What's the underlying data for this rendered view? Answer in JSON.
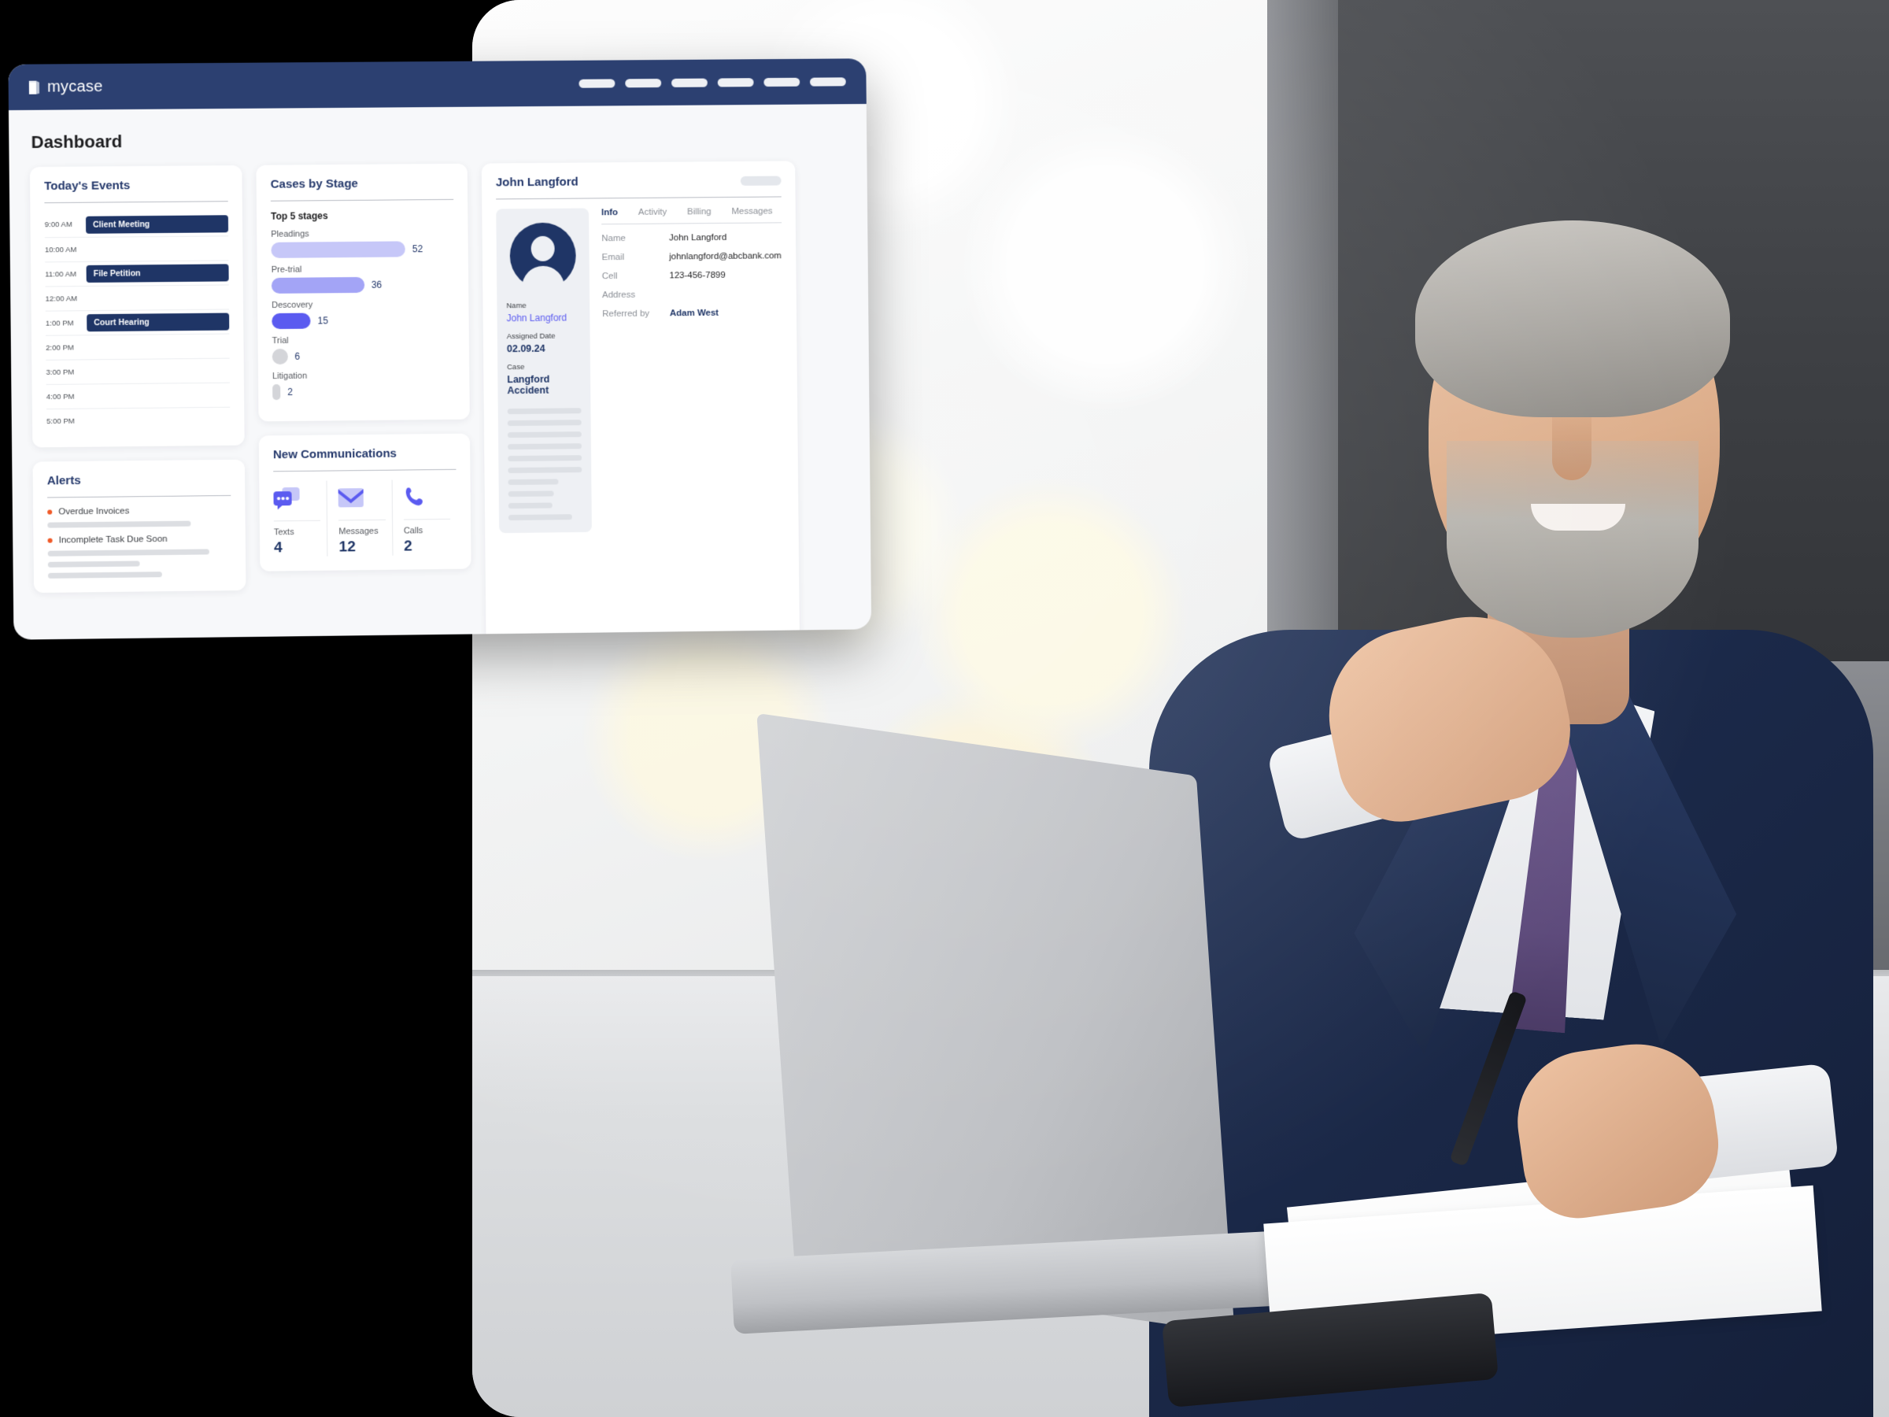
{
  "app": {
    "brand": "mycase",
    "brand_icon": "book-icon",
    "nav_placeholder_count": 6,
    "topbar_color": "#2c4071"
  },
  "page": {
    "title": "Dashboard"
  },
  "events_card": {
    "title": "Today's Events",
    "rows": [
      {
        "time": "9:00 AM",
        "event": "Client Meeting"
      },
      {
        "time": "10:00 AM",
        "event": ""
      },
      {
        "time": "11:00 AM",
        "event": "File Petition"
      },
      {
        "time": "12:00 AM",
        "event": ""
      },
      {
        "time": "1:00 PM",
        "event": "Court Hearing"
      },
      {
        "time": "2:00 PM",
        "event": ""
      },
      {
        "time": "3:00 PM",
        "event": ""
      },
      {
        "time": "4:00 PM",
        "event": ""
      },
      {
        "time": "5:00 PM",
        "event": ""
      }
    ]
  },
  "stages_card": {
    "title": "Cases by Stage",
    "subtitle": "Top 5 stages"
  },
  "chart_data": {
    "type": "bar",
    "title": "Cases by Stage",
    "subtitle": "Top 5 stages",
    "orientation": "horizontal",
    "categories": [
      "Pleadings",
      "Pre-trial",
      "Descovery",
      "Trial",
      "Litigation"
    ],
    "values": [
      52,
      36,
      15,
      6,
      2
    ],
    "colors": [
      "#c6c7f8",
      "#a3a4f6",
      "#5b5bf0",
      "#d4d5d9",
      "#d4d5d9"
    ],
    "xlabel": "",
    "ylabel": "",
    "xlim": [
      0,
      52
    ],
    "grid": false,
    "legend": "none",
    "value_labels": true
  },
  "alerts_card": {
    "title": "Alerts",
    "accent_color": "#f05a28",
    "items": [
      {
        "label": "Overdue Invoices",
        "skeleton_widths": [
          "78%"
        ]
      },
      {
        "label": "Incomplete Task Due Soon",
        "skeleton_widths": [
          "88%",
          "50%",
          "62%"
        ]
      }
    ]
  },
  "comms_card": {
    "title": "New Communications",
    "items": [
      {
        "icon": "chat-bubbles-icon",
        "label": "Texts",
        "value": "4"
      },
      {
        "icon": "envelope-icon",
        "label": "Messages",
        "value": "12"
      },
      {
        "icon": "phone-icon",
        "label": "Calls",
        "value": "2"
      }
    ]
  },
  "contact_card": {
    "title": "John Langford",
    "avatar_icon": "user-avatar-icon",
    "side_panel": {
      "name_label": "Name",
      "name_value": "John Langford",
      "assigned_label": "Assigned Date",
      "assigned_value": "02.09.24",
      "case_label": "Case",
      "case_value": "Langford Accident",
      "skeleton_widths": [
        "100%",
        "100%",
        "100%",
        "100%",
        "100%",
        "100%",
        "68%",
        "62%",
        "60%",
        "86%"
      ]
    },
    "tabs": [
      {
        "label": "Info",
        "active": true
      },
      {
        "label": "Activity",
        "active": false
      },
      {
        "label": "Billing",
        "active": false
      },
      {
        "label": "Messages",
        "active": false
      }
    ],
    "fields": [
      {
        "key": "Name",
        "value": "John Langford",
        "accent": false
      },
      {
        "key": "Email",
        "value": "johnlangford@abcbank.com",
        "accent": false
      },
      {
        "key": "Cell",
        "value": "123-456-7899",
        "accent": false
      },
      {
        "key": "Address",
        "value": "",
        "accent": false
      },
      {
        "key": "Referred by",
        "value": "Adam West",
        "accent": true
      }
    ]
  }
}
